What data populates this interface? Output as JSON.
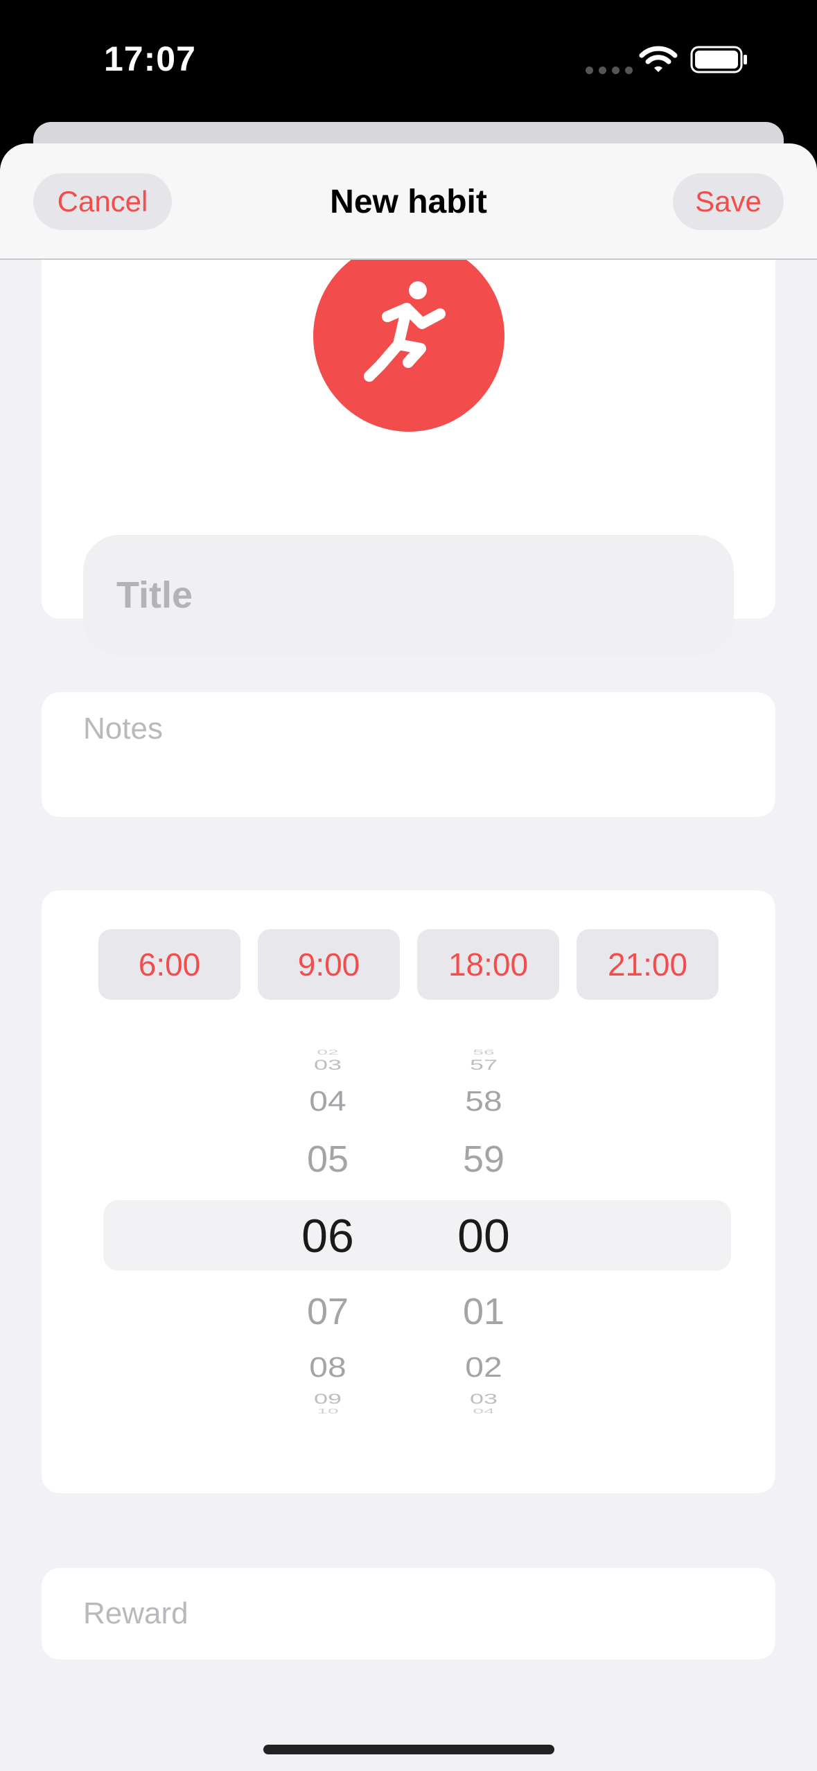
{
  "status": {
    "time": "17:07"
  },
  "nav": {
    "cancel_label": "Cancel",
    "title": "New habit",
    "save_label": "Save"
  },
  "habit": {
    "icon": "running-figure-icon",
    "color": "#f24c4c",
    "title_placeholder": "Title"
  },
  "notes": {
    "placeholder": "Notes"
  },
  "time_presets": [
    "6:00",
    "9:00",
    "18:00",
    "21:00"
  ],
  "picker": {
    "hours": {
      "above": [
        "02",
        "03",
        "04",
        "05"
      ],
      "selected": "06",
      "below": [
        "07",
        "08",
        "09",
        "10"
      ]
    },
    "minutes": {
      "above": [
        "56",
        "57",
        "58",
        "59"
      ],
      "selected": "00",
      "below": [
        "01",
        "02",
        "03",
        "04"
      ]
    }
  },
  "reward": {
    "placeholder": "Reward"
  },
  "colors": {
    "accent": "#f24d4d",
    "background": "#f1f1f6"
  }
}
